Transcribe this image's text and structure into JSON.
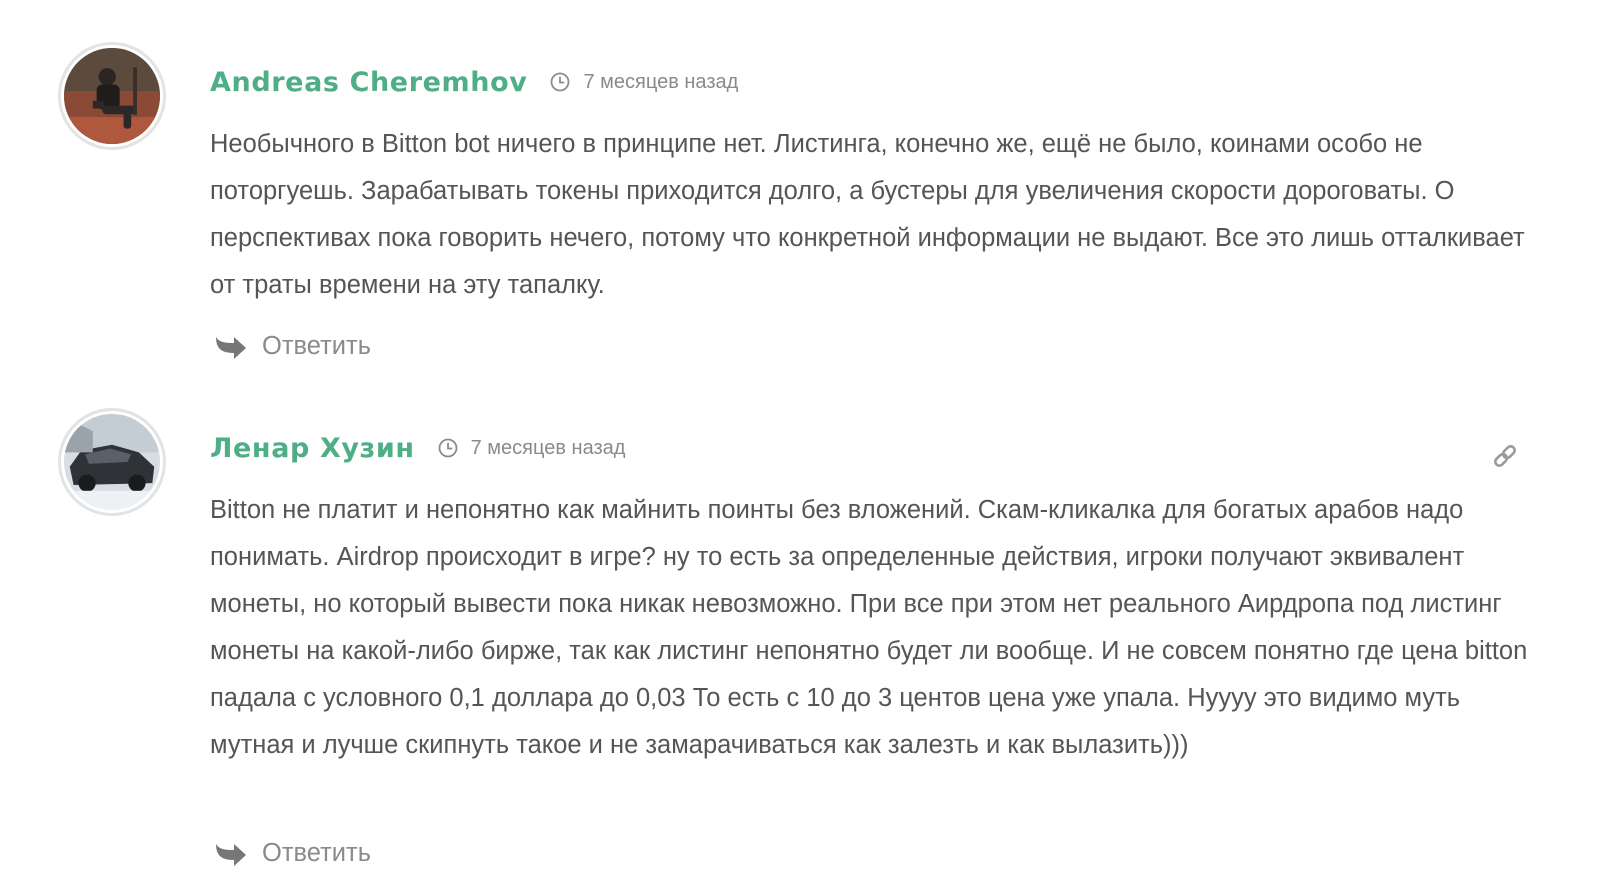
{
  "comments": [
    {
      "author": "Andreas Cheremhov",
      "time": "7 месяцев назад",
      "text": "Необычного в Bitton bot ничего в принципе нет. Листинга, конечно же, ещё не было, коинами особо не поторгуешь. Зарабатывать токены приходится долго, а бустеры для увеличения скорости дороговаты. О перспективах пока говорить нечего, потому что конкретной информации не выдают. Все это лишь отталкивает от траты времени на эту тапалку.",
      "reply_label": "Ответить",
      "avatar_icon": "user-photo-outdoor"
    },
    {
      "author": "Ленар Хузин",
      "time": "7 месяцев назад",
      "text": "Bitton не платит и непонятно как майнить поинты без вложений. Скам-кликалка для богатых арабов надо понимать. Airdrop происходит в игре? ну то есть за определенные действия, игроки получают эквивалент монеты, но который вывести пока никак невозможно. При все при этом нет реального Аирдропа под листинг монеты на какой-либо бирже, так как листинг непонятно будет ли вообще. И не совсем понятно где цена bitton падала с условного 0,1 доллара до 0,03 То есть с 10 до 3 центов цена уже упала. Нуууу это видимо муть мутная и лучше скипнуть такое и не замарачиваться как залезть и как вылазить)))",
      "reply_label": "Ответить",
      "avatar_icon": "user-photo-car-snow",
      "permalink_icon": "link-icon"
    }
  ],
  "colors": {
    "author": "#4fae86",
    "text": "#555555",
    "muted": "#8a8a8a"
  }
}
